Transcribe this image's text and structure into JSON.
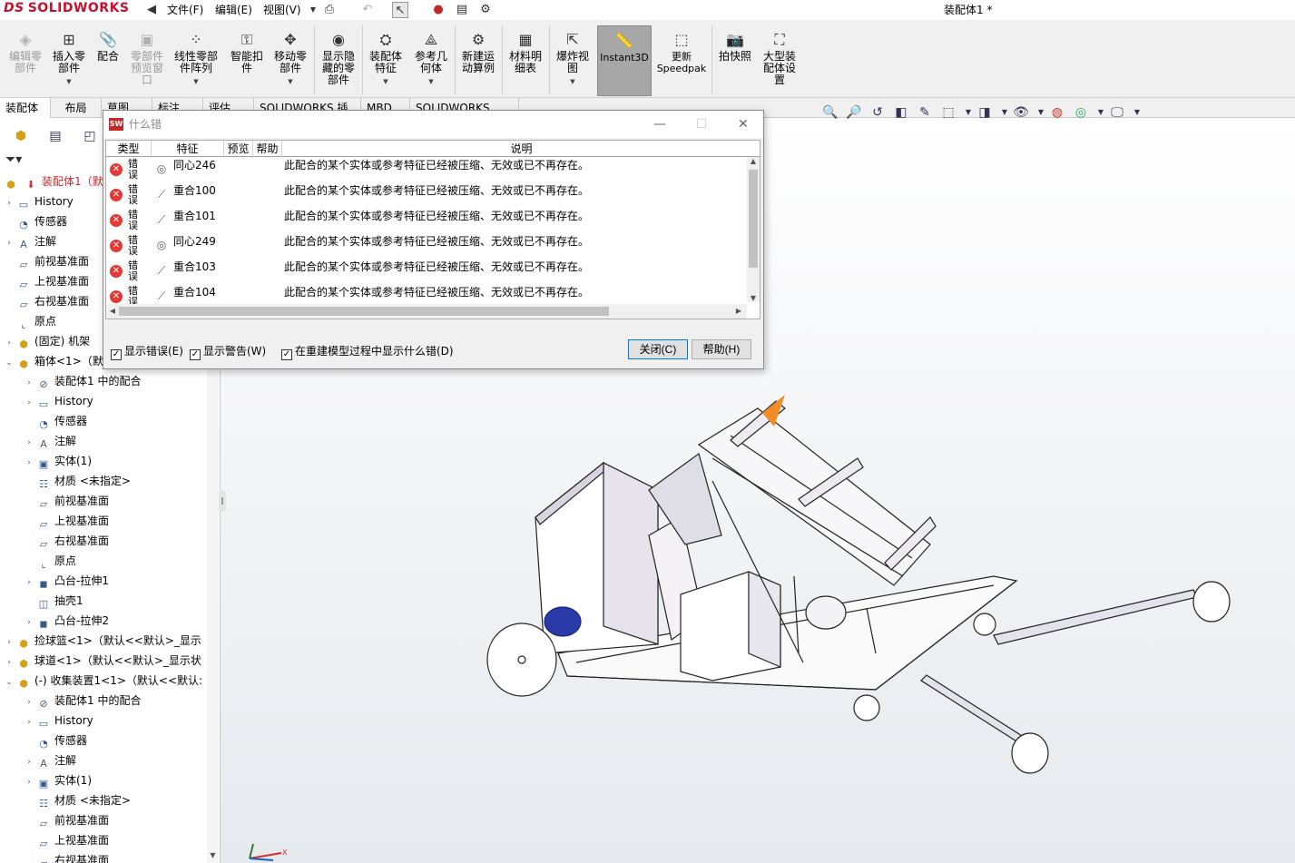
{
  "app": {
    "brand": "SOLIDWORKS",
    "brand_prefix": "DS",
    "title": "装配体1 *"
  },
  "menu": {
    "file": "文件(F)",
    "edit": "编辑(E)",
    "view": "视图(V)"
  },
  "ribbon": {
    "edit_component": "编辑零\n部件",
    "insert_component": "插入零\n部件",
    "mate": "配合",
    "component_preview": "零部件\n预览窗\n口",
    "linear_pattern": "线性零部\n件阵列",
    "smart_fasteners": "智能扣\n件",
    "move_component": "移动零\n部件",
    "show_hidden": "显示隐\n藏的零\n部件",
    "assembly_features": "装配体\n特征",
    "reference_geometry": "参考几\n何体",
    "new_motion_study": "新建运\n动算例",
    "bom": "材料明\n细表",
    "exploded_view": "爆炸视\n图",
    "instant3d": "Instant3D",
    "update_speedpak": "更新\nSpeedpak",
    "snapshot": "拍快照",
    "large_assembly": "大型装\n配体设\n置"
  },
  "tabs": [
    "装配体",
    "布局",
    "草图",
    "标注",
    "评估",
    "SOLIDWORKS 插件",
    "MBD",
    "SOLIDWORKS CAM"
  ],
  "tree": {
    "root": "装配体1（默",
    "items": [
      "History",
      "传感器",
      "注解",
      "前视基准面",
      "上视基准面",
      "右视基准面",
      "原点",
      "(固定) 机架",
      "箱体<1>（默",
      "装配体1 中的配合",
      "History",
      "传感器",
      "注解",
      "实体(1)",
      "材质 <未指定>",
      "前视基准面",
      "上视基准面",
      "右视基准面",
      "原点",
      "凸台-拉伸1",
      "抽壳1",
      "凸台-拉伸2",
      "捡球篮<1>（默认<<默认>_显示",
      "球道<1>（默认<<默认>_显示状",
      "(-) 收集装置1<1>（默认<<默认:",
      "装配体1 中的配合",
      "History",
      "传感器",
      "注解",
      "实体(1)",
      "材质 <未指定>",
      "前视基准面",
      "上视基准面",
      "右视基准面"
    ]
  },
  "dialog": {
    "title": "什么错",
    "columns": {
      "type": "类型",
      "feature": "特征",
      "preview": "预览",
      "help": "帮助",
      "description": "说明"
    },
    "rows": [
      {
        "type": "错误",
        "feature": "同心246",
        "description": "此配合的某个实体或参考特征已经被压缩、无效或已不再存在。"
      },
      {
        "type": "错误",
        "feature": "重合100",
        "description": "此配合的某个实体或参考特征已经被压缩、无效或已不再存在。"
      },
      {
        "type": "错误",
        "feature": "重合101",
        "description": "此配合的某个实体或参考特征已经被压缩、无效或已不再存在。"
      },
      {
        "type": "错误",
        "feature": "同心249",
        "description": "此配合的某个实体或参考特征已经被压缩、无效或已不再存在。"
      },
      {
        "type": "错误",
        "feature": "重合103",
        "description": "此配合的某个实体或参考特征已经被压缩、无效或已不再存在。"
      },
      {
        "type": "错误",
        "feature": "重合104",
        "description": "此配合的某个实体或参考特征已经被压缩、无效或已不再存在。"
      }
    ],
    "show_errors": "显示错误(E)",
    "show_warnings": "显示警告(W)",
    "show_during_rebuild": "在重建模型过程中显示什么错(D)",
    "close": "关闭(C)",
    "help": "帮助(H)"
  },
  "colors": {
    "brand": "#c8102e",
    "error": "#e53935",
    "accent": "#0078d7",
    "instant3d_bg": "#a7a7a7"
  }
}
